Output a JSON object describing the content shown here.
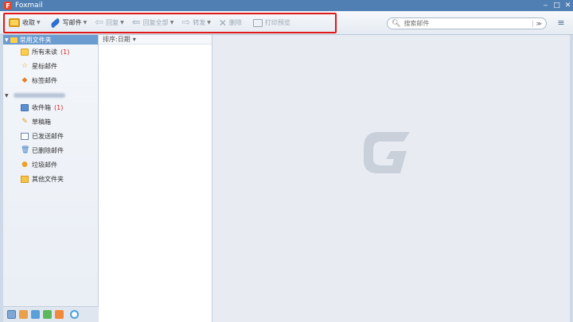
{
  "window": {
    "title": "Foxmail",
    "logo": "F",
    "min": "‒",
    "max": "□",
    "close": "✕"
  },
  "toolbar": {
    "receive": "收取",
    "write": "写邮件",
    "reply": "回复",
    "reply_all": "回复全部",
    "forward": "转发",
    "delete": "删除",
    "print_preview": "打印预览"
  },
  "search": {
    "placeholder": "搜索邮件",
    "dropdown": "≫"
  },
  "menu_icon": "≡",
  "sidebar": {
    "common_group": "常用文件夹",
    "common_items": [
      {
        "label": "所有未读",
        "count": "(1)"
      },
      {
        "label": "星标邮件",
        "count": ""
      },
      {
        "label": "标签邮件",
        "count": ""
      }
    ],
    "account_items": [
      {
        "label": "收件箱",
        "count": "(1)"
      },
      {
        "label": "草稿箱",
        "count": ""
      },
      {
        "label": "已发送邮件",
        "count": ""
      },
      {
        "label": "已删除邮件",
        "count": ""
      },
      {
        "label": "垃圾邮件",
        "count": ""
      },
      {
        "label": "其他文件夹",
        "count": ""
      }
    ]
  },
  "maillist": {
    "sort_label": "排序:日期",
    "sort_caret": "▾"
  },
  "colors": {
    "accent": "#4f7fb3",
    "highlight_border": "#e01818",
    "watermark": "#c9d0da"
  }
}
